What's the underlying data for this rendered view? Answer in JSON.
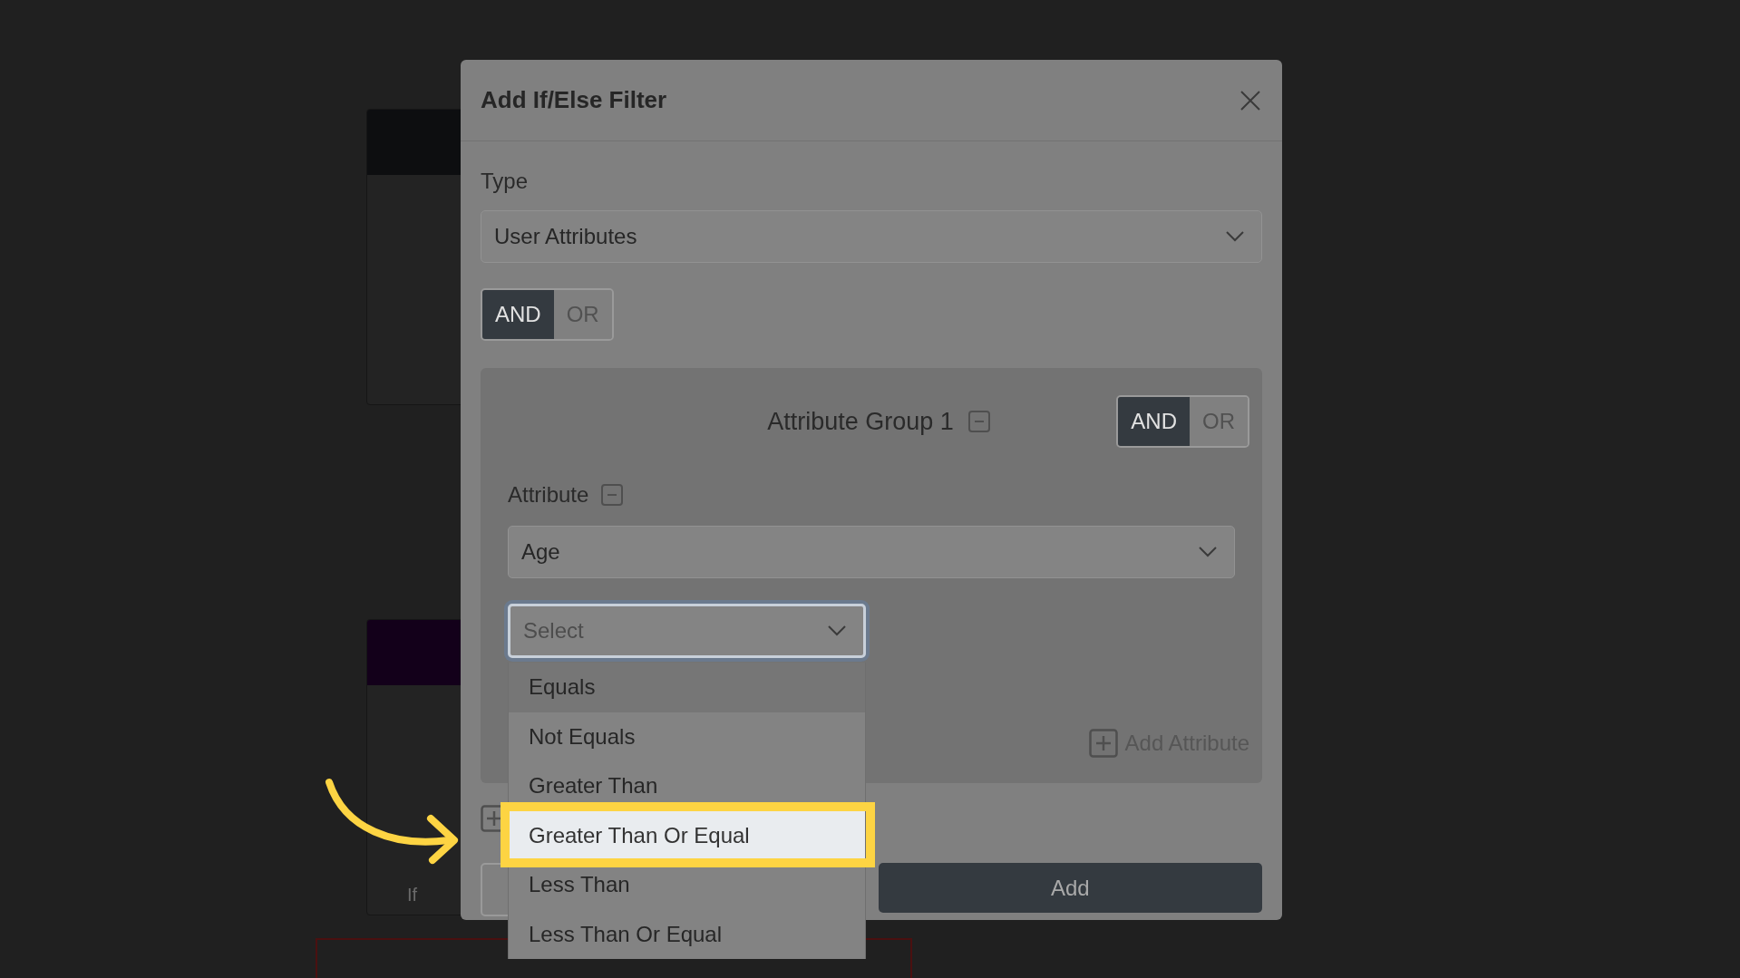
{
  "canvas": {
    "nodes": [
      {
        "color": "#0d0e10"
      },
      {
        "color": "#13001a",
        "label": "If"
      }
    ]
  },
  "dialog": {
    "title": "Add If/Else Filter",
    "type_label": "Type",
    "type_select": {
      "value": "User Attributes"
    },
    "join_toggle": [
      {
        "label": "AND",
        "selected": true
      },
      {
        "label": "OR",
        "selected": false
      }
    ],
    "group": {
      "title": "Attribute Group 1",
      "join_toggle": [
        {
          "label": "AND",
          "selected": true
        },
        {
          "label": "OR",
          "selected": false
        }
      ],
      "attribute_label": "Attribute",
      "attribute_select": {
        "value": "Age"
      },
      "operator_select": {
        "placeholder": "Select",
        "focused": true
      },
      "add_attribute": "Add Attribute"
    },
    "operator_options": [
      {
        "label": "Equals",
        "hovered": true,
        "selected": false,
        "callout": false
      },
      {
        "label": "Not Equals",
        "hovered": false,
        "selected": false,
        "callout": false
      },
      {
        "label": "Greater Than",
        "hovered": false,
        "selected": false,
        "callout": false
      },
      {
        "label": "Greater Than Or Equal",
        "hovered": false,
        "selected": true,
        "callout": true
      },
      {
        "label": "Less Than",
        "hovered": false,
        "selected": false,
        "callout": false
      },
      {
        "label": "Less Than Or Equal",
        "hovered": false,
        "selected": false,
        "callout": false
      }
    ],
    "add_button": "Add"
  }
}
